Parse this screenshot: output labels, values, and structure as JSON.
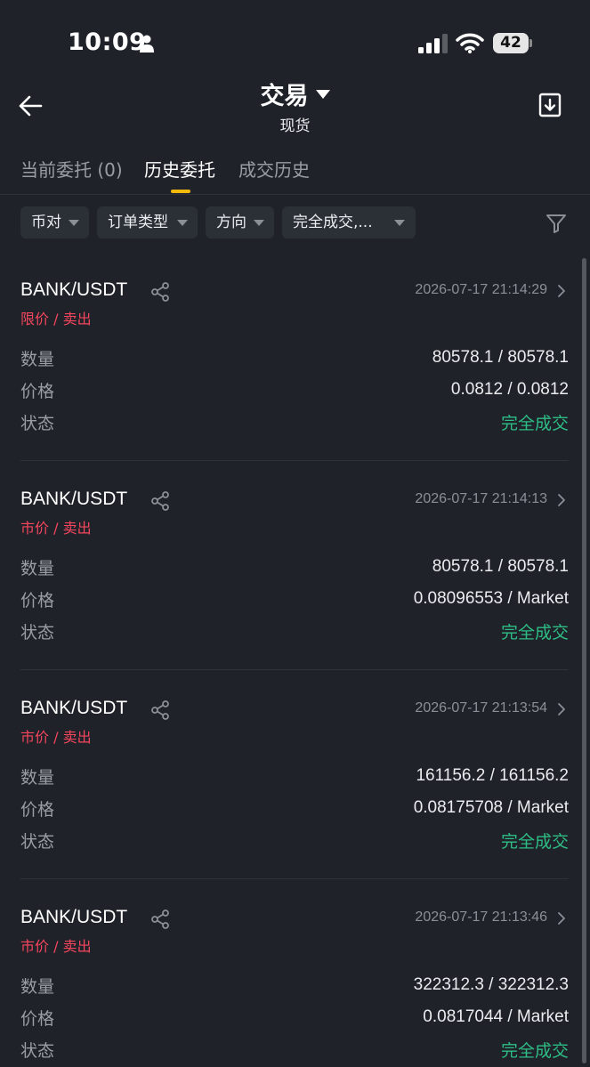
{
  "status_bar": {
    "time": "10:09",
    "battery": "42"
  },
  "header": {
    "title": "交易",
    "subtitle": "现货"
  },
  "tabs": [
    {
      "label": "当前委托 (0)",
      "active": false
    },
    {
      "label": "历史委托",
      "active": true
    },
    {
      "label": "成交历史",
      "active": false
    }
  ],
  "filters": [
    {
      "label": "币对"
    },
    {
      "label": "订单类型"
    },
    {
      "label": "方向"
    },
    {
      "label": "完全成交,..."
    }
  ],
  "row_labels": {
    "quantity": "数量",
    "price": "价格",
    "status": "状态"
  },
  "orders": [
    {
      "pair": "BANK/USDT",
      "datetime": "2026-07-17 21:14:29",
      "side": "限价 / 卖出",
      "quantity": "80578.1 / 80578.1",
      "price": "0.0812 / 0.0812",
      "status": "完全成交"
    },
    {
      "pair": "BANK/USDT",
      "datetime": "2026-07-17 21:14:13",
      "side": "市价 / 卖出",
      "quantity": "80578.1 / 80578.1",
      "price": "0.08096553 / Market",
      "status": "完全成交"
    },
    {
      "pair": "BANK/USDT",
      "datetime": "2026-07-17 21:13:54",
      "side": "市价 / 卖出",
      "quantity": "161156.2 / 161156.2",
      "price": "0.08175708 / Market",
      "status": "完全成交"
    },
    {
      "pair": "BANK/USDT",
      "datetime": "2026-07-17 21:13:46",
      "side": "市价 / 卖出",
      "quantity": "322312.3 / 322312.3",
      "price": "0.0817044 / Market",
      "status": "完全成交"
    }
  ],
  "colors": {
    "background": "#1f2229",
    "accent": "#f0b90b",
    "sell": "#f6465d",
    "filled": "#2ebd85"
  }
}
